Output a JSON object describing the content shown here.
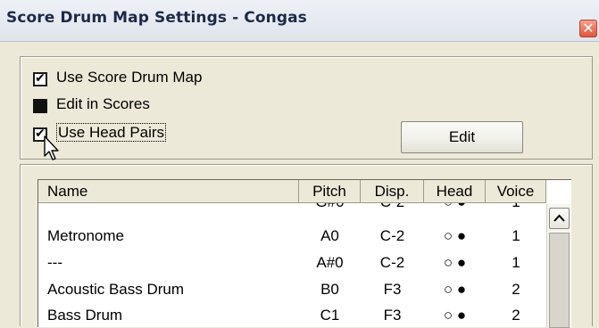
{
  "window": {
    "title": "Score Drum Map Settings - Congas",
    "close_glyph": "✕"
  },
  "options": [
    {
      "label": "Use Score Drum Map",
      "state": "checked"
    },
    {
      "label": "Edit in Scores",
      "state": "filled"
    },
    {
      "label": "Use Head Pairs",
      "state": "checked"
    }
  ],
  "edit_button": {
    "label": "Edit"
  },
  "table": {
    "columns": [
      "Name",
      "Pitch",
      "Disp.",
      "Head",
      "Voice"
    ],
    "partial_row": {
      "name": "---",
      "pitch": "G#0",
      "disp": "C-2",
      "head": "○ ●",
      "voice": "1"
    },
    "rows": [
      {
        "name": "Metronome",
        "pitch": "A0",
        "disp": "C-2",
        "head": "○ ●",
        "voice": "1"
      },
      {
        "name": "---",
        "pitch": "A#0",
        "disp": "C-2",
        "head": "○ ●",
        "voice": "1"
      },
      {
        "name": "Acoustic Bass Drum",
        "pitch": "B0",
        "disp": "F3",
        "head": "○ ●",
        "voice": "2"
      },
      {
        "name": "Bass Drum",
        "pitch": "C1",
        "disp": "F3",
        "head": "○ ●",
        "voice": "2"
      }
    ]
  }
}
